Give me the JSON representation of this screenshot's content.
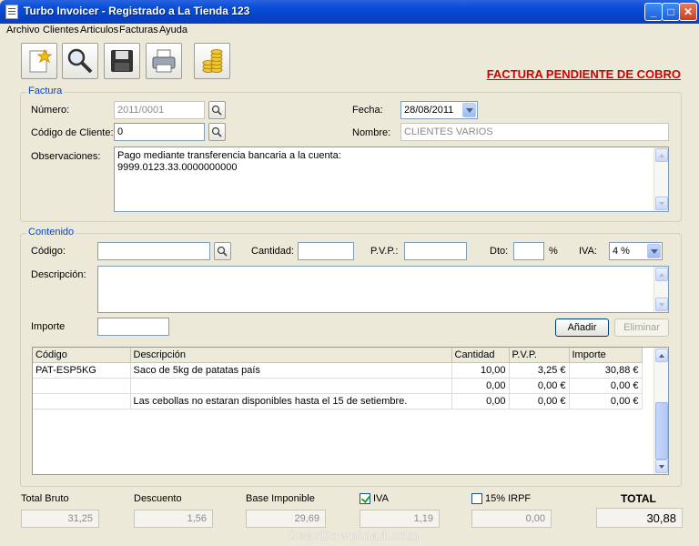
{
  "window": {
    "title": "Turbo Invoicer - Registrado a La Tienda 123"
  },
  "menu": [
    "Archivo",
    "Clientes",
    "Articulos",
    "Facturas",
    "Ayuda"
  ],
  "toolbar": {
    "icons": [
      "new-document-icon",
      "search-icon",
      "save-icon",
      "print-icon",
      "coins-icon"
    ]
  },
  "status_banner": "FACTURA PENDIENTE DE COBRO",
  "factura": {
    "group_title": "Factura",
    "numero_label": "Número:",
    "numero_value": "2011/0001",
    "fecha_label": "Fecha:",
    "fecha_value": "28/08/2011",
    "cliente_label": "Código de Cliente:",
    "cliente_value": "0",
    "nombre_label": "Nombre:",
    "nombre_value": "CLIENTES VARIOS",
    "obs_label": "Observaciones:",
    "obs_line1": "Pago mediante transferencia bancaria a la cuenta:",
    "obs_line2": "9999.0123.33.0000000000"
  },
  "contenido": {
    "group_title": "Contenido",
    "codigo_label": "Código:",
    "codigo_value": "",
    "cantidad_label": "Cantidad:",
    "cantidad_value": "",
    "pvp_label": "P.V.P.:",
    "pvp_value": "",
    "dto_label": "Dto:",
    "dto_value": "",
    "percent": "%",
    "iva_label": "IVA:",
    "iva_value": "4 %",
    "descripcion_label": "Descripción:",
    "descripcion_value": "",
    "importe_label": "Importe",
    "importe_value": "",
    "add_button": "Añadir",
    "delete_button": "Eliminar"
  },
  "table": {
    "columns": [
      "Código",
      "Descripción",
      "Cantidad",
      "P.V.P.",
      "Importe"
    ],
    "rows": [
      [
        "PAT-ESP5KG",
        "Saco de 5kg de patatas país",
        "10,00",
        "3,25 €",
        "30,88 €"
      ],
      [
        "",
        "",
        "0,00",
        "0,00 €",
        "0,00 €"
      ],
      [
        "",
        "Las cebollas no estaran disponibles hasta el 15 de setiembre.",
        "0,00",
        "0,00 €",
        "0,00 €"
      ]
    ]
  },
  "totals": {
    "bruto_label": "Total Bruto",
    "bruto_value": "31,25",
    "descuento_label": "Descuento",
    "descuento_value": "1,56",
    "base_label": "Base Imponible",
    "base_value": "29,69",
    "iva_label": "IVA",
    "iva_checked": true,
    "iva_value": "1,19",
    "irpf_label": "15% IRPF",
    "irpf_checked": false,
    "irpf_value": "0,00",
    "total_label": "TOTAL",
    "total_value": "30,88"
  },
  "watermark": "GearDownload.com"
}
